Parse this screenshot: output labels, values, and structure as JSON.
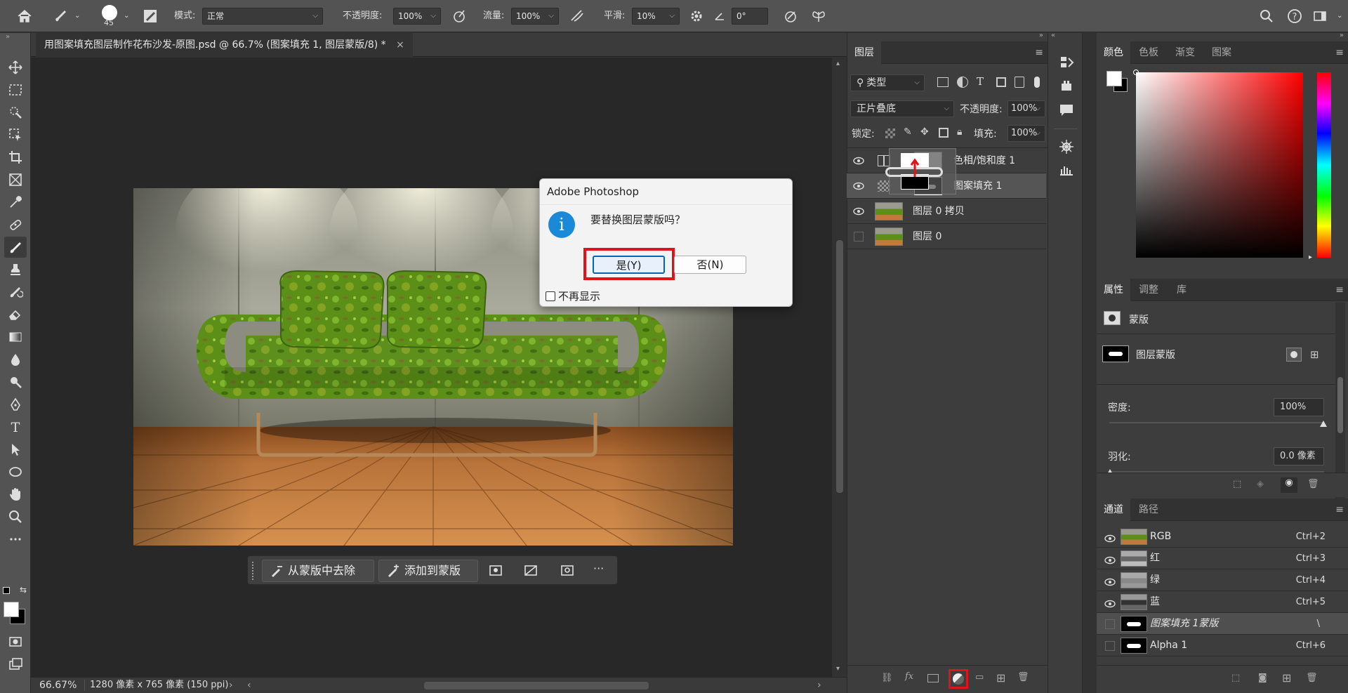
{
  "options_bar": {
    "brush_size": "45",
    "mode_label": "模式:",
    "mode_value": "正常",
    "opacity_label": "不透明度:",
    "opacity_value": "100%",
    "flow_label": "流量:",
    "flow_value": "100%",
    "smooth_label": "平滑:",
    "smooth_value": "10%",
    "angle_value": "0°"
  },
  "document": {
    "tab_title": "用图案填充图层制作花布沙发-原图.psd @ 66.7% (图案填充 1, 图层蒙版/8) *",
    "close": "×"
  },
  "status": {
    "zoom": "66.67%",
    "info": "1280 像素 x 765 像素 (150 ppi)"
  },
  "context_bar": {
    "remove_from_mask": "从蒙版中去除",
    "add_to_mask": "添加到蒙版",
    "more": "···"
  },
  "dialog": {
    "title": "Adobe Photoshop",
    "message": "要替换图层蒙版吗？",
    "yes": "是(Y)",
    "no": "否(N)",
    "dont_show": "不再显示",
    "info_glyph": "i"
  },
  "layers_panel": {
    "tab": "图层",
    "filter_label": "类型",
    "blend_mode": "正片叠底",
    "opacity_label": "不透明度:",
    "opacity_value": "100%",
    "lock_label": "锁定:",
    "fill_label": "填充:",
    "fill_value": "100%",
    "layers": [
      {
        "name": "色相/饱和度 1",
        "visible": true
      },
      {
        "name": "图案填充 1",
        "visible": true
      },
      {
        "name": "图层 0 拷贝",
        "visible": true
      },
      {
        "name": "图层 0",
        "visible": false
      }
    ]
  },
  "color_panel": {
    "tabs": [
      "颜色",
      "色板",
      "渐变",
      "图案"
    ]
  },
  "properties_panel": {
    "tabs": [
      "属性",
      "调整",
      "库"
    ],
    "mask_header": "蒙版",
    "layer_mask": "图层蒙版",
    "density_label": "密度:",
    "density_value": "100%",
    "feather_label": "羽化:",
    "feather_value": "0.0 像素"
  },
  "channels_panel": {
    "tabs": [
      "通道",
      "路径"
    ],
    "channels": [
      {
        "name": "RGB",
        "shortcut": "Ctrl+2",
        "visible": true
      },
      {
        "name": "红",
        "shortcut": "Ctrl+3",
        "visible": true
      },
      {
        "name": "绿",
        "shortcut": "Ctrl+4",
        "visible": true
      },
      {
        "name": "蓝",
        "shortcut": "Ctrl+5",
        "visible": true
      },
      {
        "name": "图案填充 1蒙版",
        "shortcut": "\\",
        "visible": false
      },
      {
        "name": "Alpha 1",
        "shortcut": "Ctrl+6",
        "visible": false
      }
    ]
  },
  "colors": {
    "highlight_red": "#e0131b",
    "accent_blue": "#0067c0",
    "info_blue": "#1a8ad8"
  }
}
